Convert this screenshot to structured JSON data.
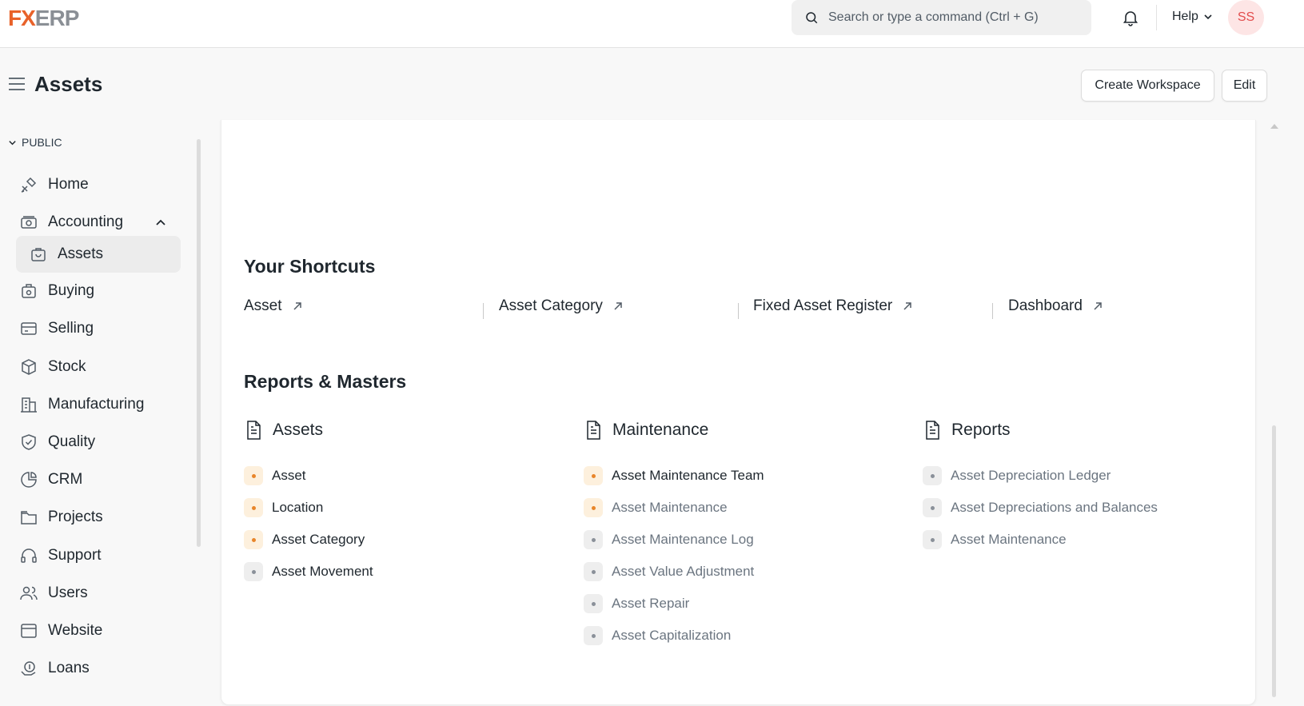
{
  "app": {
    "logo_prefix": "F",
    "logo_mid": "X",
    "logo_suffix": "ERP"
  },
  "navbar": {
    "search_placeholder": "Search or type a command (Ctrl + G)",
    "help_label": "Help",
    "avatar_initials": "SS"
  },
  "header": {
    "title": "Assets",
    "create_workspace_label": "Create Workspace",
    "edit_label": "Edit"
  },
  "sidebar": {
    "section_label": "PUBLIC",
    "items": [
      {
        "label": "Home",
        "icon": "home-icon"
      },
      {
        "label": "Accounting",
        "icon": "accounting-icon"
      },
      {
        "label": "Assets",
        "icon": "assets-icon"
      },
      {
        "label": "Buying",
        "icon": "buying-icon"
      },
      {
        "label": "Selling",
        "icon": "selling-icon"
      },
      {
        "label": "Stock",
        "icon": "stock-icon"
      },
      {
        "label": "Manufacturing",
        "icon": "manufacturing-icon"
      },
      {
        "label": "Quality",
        "icon": "quality-icon"
      },
      {
        "label": "CRM",
        "icon": "crm-icon"
      },
      {
        "label": "Projects",
        "icon": "projects-icon"
      },
      {
        "label": "Support",
        "icon": "support-icon"
      },
      {
        "label": "Users",
        "icon": "users-icon"
      },
      {
        "label": "Website",
        "icon": "website-icon"
      },
      {
        "label": "Loans",
        "icon": "loans-icon"
      }
    ]
  },
  "shortcuts": {
    "title": "Your Shortcuts",
    "items": [
      "Asset",
      "Asset Category",
      "Fixed Asset Register",
      "Dashboard"
    ]
  },
  "reports": {
    "title": "Reports & Masters",
    "columns": [
      {
        "title": "Assets",
        "links": [
          "Asset",
          "Location",
          "Asset Category",
          "Asset Movement"
        ]
      },
      {
        "title": "Maintenance",
        "links": [
          "Asset Maintenance Team",
          "Asset Maintenance",
          "Asset Maintenance Log",
          "Asset Value Adjustment",
          "Asset Repair",
          "Asset Capitalization"
        ]
      },
      {
        "title": "Reports",
        "links": [
          "Asset Depreciation Ledger",
          "Asset Depreciations and Balances",
          "Asset Maintenance"
        ]
      }
    ]
  },
  "colors": {
    "accent_orange": "#e8852a",
    "avatar_red": "#e24c4c"
  }
}
